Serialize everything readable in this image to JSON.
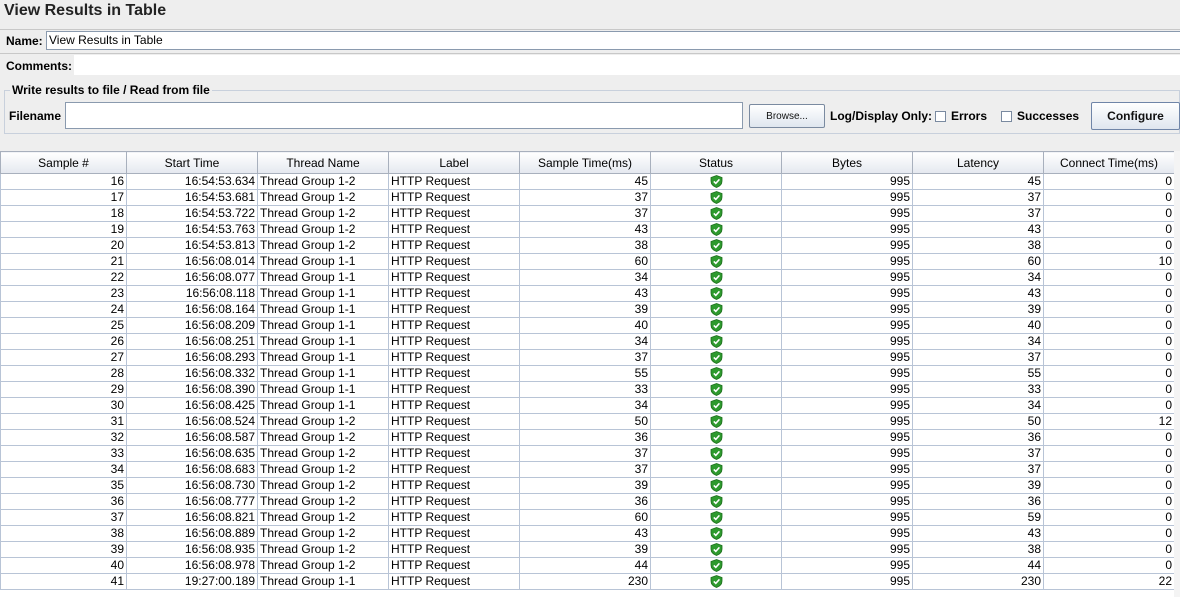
{
  "window": {
    "title": "View Results in Table"
  },
  "name_field": {
    "label": "Name:",
    "value": "View Results in Table"
  },
  "comments_field": {
    "label": "Comments:"
  },
  "file_section": {
    "legend": "Write results to file / Read from file",
    "filename_label": "Filename",
    "filename_value": "",
    "browse_label": "Browse...",
    "log_display_label": "Log/Display Only:",
    "errors_label": "Errors",
    "successes_label": "Successes",
    "configure_label": "Configure"
  },
  "table": {
    "columns": [
      "Sample #",
      "Start Time",
      "Thread Name",
      "Label",
      "Sample Time(ms)",
      "Status",
      "Bytes",
      "Latency",
      "Connect Time(ms)"
    ],
    "status_icon": "success-shield-icon",
    "status_color": "#2e9a2e",
    "rows": [
      [
        "16",
        "16:54:53.634",
        "Thread Group 1-2",
        "HTTP Request",
        "45",
        "",
        "995",
        "45",
        "0"
      ],
      [
        "17",
        "16:54:53.681",
        "Thread Group 1-2",
        "HTTP Request",
        "37",
        "",
        "995",
        "37",
        "0"
      ],
      [
        "18",
        "16:54:53.722",
        "Thread Group 1-2",
        "HTTP Request",
        "37",
        "",
        "995",
        "37",
        "0"
      ],
      [
        "19",
        "16:54:53.763",
        "Thread Group 1-2",
        "HTTP Request",
        "43",
        "",
        "995",
        "43",
        "0"
      ],
      [
        "20",
        "16:54:53.813",
        "Thread Group 1-2",
        "HTTP Request",
        "38",
        "",
        "995",
        "38",
        "0"
      ],
      [
        "21",
        "16:56:08.014",
        "Thread Group 1-1",
        "HTTP Request",
        "60",
        "",
        "995",
        "60",
        "10"
      ],
      [
        "22",
        "16:56:08.077",
        "Thread Group 1-1",
        "HTTP Request",
        "34",
        "",
        "995",
        "34",
        "0"
      ],
      [
        "23",
        "16:56:08.118",
        "Thread Group 1-1",
        "HTTP Request",
        "43",
        "",
        "995",
        "43",
        "0"
      ],
      [
        "24",
        "16:56:08.164",
        "Thread Group 1-1",
        "HTTP Request",
        "39",
        "",
        "995",
        "39",
        "0"
      ],
      [
        "25",
        "16:56:08.209",
        "Thread Group 1-1",
        "HTTP Request",
        "40",
        "",
        "995",
        "40",
        "0"
      ],
      [
        "26",
        "16:56:08.251",
        "Thread Group 1-1",
        "HTTP Request",
        "34",
        "",
        "995",
        "34",
        "0"
      ],
      [
        "27",
        "16:56:08.293",
        "Thread Group 1-1",
        "HTTP Request",
        "37",
        "",
        "995",
        "37",
        "0"
      ],
      [
        "28",
        "16:56:08.332",
        "Thread Group 1-1",
        "HTTP Request",
        "55",
        "",
        "995",
        "55",
        "0"
      ],
      [
        "29",
        "16:56:08.390",
        "Thread Group 1-1",
        "HTTP Request",
        "33",
        "",
        "995",
        "33",
        "0"
      ],
      [
        "30",
        "16:56:08.425",
        "Thread Group 1-1",
        "HTTP Request",
        "34",
        "",
        "995",
        "34",
        "0"
      ],
      [
        "31",
        "16:56:08.524",
        "Thread Group 1-2",
        "HTTP Request",
        "50",
        "",
        "995",
        "50",
        "12"
      ],
      [
        "32",
        "16:56:08.587",
        "Thread Group 1-2",
        "HTTP Request",
        "36",
        "",
        "995",
        "36",
        "0"
      ],
      [
        "33",
        "16:56:08.635",
        "Thread Group 1-2",
        "HTTP Request",
        "37",
        "",
        "995",
        "37",
        "0"
      ],
      [
        "34",
        "16:56:08.683",
        "Thread Group 1-2",
        "HTTP Request",
        "37",
        "",
        "995",
        "37",
        "0"
      ],
      [
        "35",
        "16:56:08.730",
        "Thread Group 1-2",
        "HTTP Request",
        "39",
        "",
        "995",
        "39",
        "0"
      ],
      [
        "36",
        "16:56:08.777",
        "Thread Group 1-2",
        "HTTP Request",
        "36",
        "",
        "995",
        "36",
        "0"
      ],
      [
        "37",
        "16:56:08.821",
        "Thread Group 1-2",
        "HTTP Request",
        "60",
        "",
        "995",
        "59",
        "0"
      ],
      [
        "38",
        "16:56:08.889",
        "Thread Group 1-2",
        "HTTP Request",
        "43",
        "",
        "995",
        "43",
        "0"
      ],
      [
        "39",
        "16:56:08.935",
        "Thread Group 1-2",
        "HTTP Request",
        "39",
        "",
        "995",
        "38",
        "0"
      ],
      [
        "40",
        "16:56:08.978",
        "Thread Group 1-2",
        "HTTP Request",
        "44",
        "",
        "995",
        "44",
        "0"
      ],
      [
        "41",
        "19:27:00.189",
        "Thread Group 1-1",
        "HTTP Request",
        "230",
        "",
        "995",
        "230",
        "22"
      ]
    ]
  }
}
